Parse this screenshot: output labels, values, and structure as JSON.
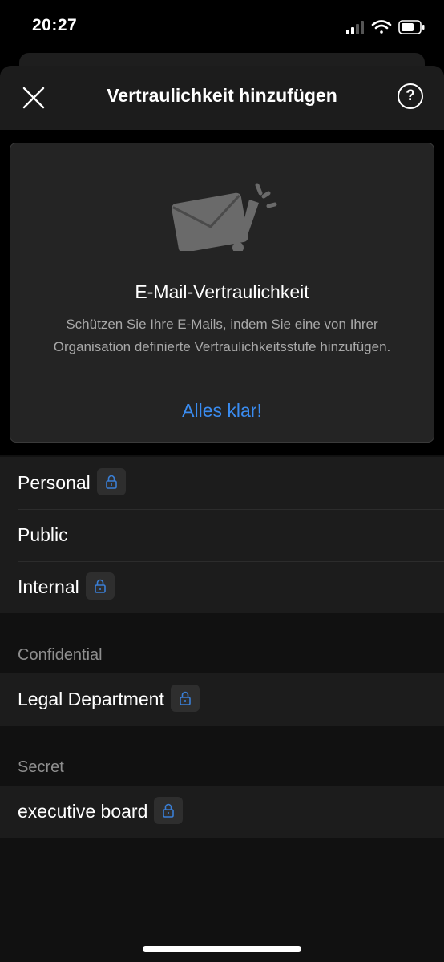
{
  "status_bar": {
    "time": "20:27"
  },
  "header": {
    "title": "Vertraulichkeit hinzufügen",
    "help_label": "?"
  },
  "banner": {
    "title": "E-Mail-Vertraulichkeit",
    "description": "Schützen Sie Ihre E-Mails, indem Sie eine von Ihrer Organisation definierte Vertraulichkeitsstufe hinzufügen.",
    "action_label": "Alles klar!"
  },
  "labels": [
    {
      "label": "Personal",
      "locked": true
    },
    {
      "label": "Public",
      "locked": false
    },
    {
      "label": "Internal",
      "locked": true
    }
  ],
  "sections": [
    {
      "title": "Confidential",
      "items": [
        {
          "label": "Legal Department",
          "locked": true
        }
      ]
    },
    {
      "title": "Secret",
      "items": [
        {
          "label": "executive board",
          "locked": true
        }
      ]
    }
  ],
  "colors": {
    "accent": "#3a8cf0",
    "lock_icon": "#3a7fd6"
  }
}
